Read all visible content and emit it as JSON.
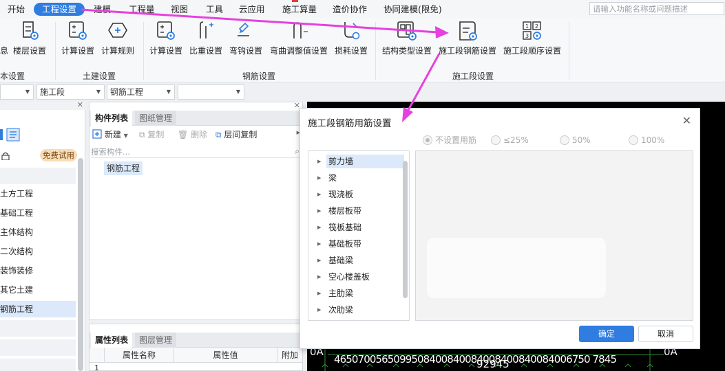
{
  "menu": {
    "items": [
      "开始",
      "工程设置",
      "建模",
      "工程量",
      "视图",
      "工具",
      "云应用",
      "施工算量",
      "造价协作",
      "协同建模(限免)"
    ],
    "active": "工程设置"
  },
  "search": {
    "placeholder": "请输入功能名称或问题描述"
  },
  "ribbon": {
    "buttons": [
      "息",
      "楼层设置",
      "计算设置",
      "计算规则",
      "计算设置",
      "比重设置",
      "弯钩设置",
      "弯曲调整值设置",
      "损耗设置",
      "结构类型设置",
      "施工段钢筋设置",
      "施工段顺序设置"
    ],
    "groups": [
      "基本设置",
      "土建设置",
      "钢筋设置",
      "施工段设置"
    ]
  },
  "filters": {
    "sel2": "施工段",
    "sel3": "钢筋工程"
  },
  "left_panel": {
    "badge": "免费试用",
    "items": [
      "土方工程",
      "基础工程",
      "主体结构",
      "二次结构",
      "装饰装修",
      "其它土建",
      "钢筋工程"
    ]
  },
  "component_panel": {
    "tabs": [
      "构件列表",
      "图纸管理"
    ],
    "toolbar": {
      "new": "新建",
      "copy": "复制",
      "delete": "删除",
      "floor_copy": "层间复制"
    },
    "search_placeholder": "搜索构件...",
    "item": "钢筋工程"
  },
  "property_panel": {
    "tabs": [
      "属性列表",
      "图层管理"
    ],
    "headers": [
      "属性名称",
      "属性值",
      "附加"
    ],
    "row_no": "1"
  },
  "canvas": {
    "axis_label": "0A",
    "dims": "4650700565099508400840084008400840084006750 7845",
    "total": "92945"
  },
  "dialog": {
    "title": "施工段钢筋用筋设置",
    "radios": [
      "不设置用筋",
      "≤25%",
      "50%",
      "100%"
    ],
    "tree": [
      "剪力墙",
      "梁",
      "现浇板",
      "楼层板带",
      "筏板基础",
      "基础板带",
      "基础梁",
      "空心楼盖板",
      "主肋梁",
      "次肋梁"
    ],
    "ok": "确定",
    "cancel": "取消"
  },
  "colors": {
    "accent": "#2f7de1",
    "annotation": "#e83fe0",
    "badge": "#f8dcb8"
  }
}
